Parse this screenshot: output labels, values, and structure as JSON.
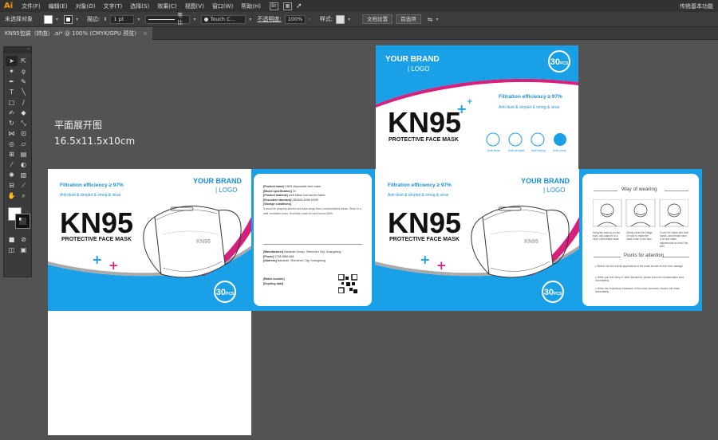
{
  "menu": {
    "logo": "Ai",
    "items": [
      "文件(F)",
      "编辑(E)",
      "对象(O)",
      "文字(T)",
      "选择(S)",
      "效果(C)",
      "视图(V)",
      "窗口(W)",
      "帮助(H)"
    ],
    "workspace": "传统基本功能"
  },
  "control": {
    "no_selection": "未选择对象",
    "stroke_label": "描边:",
    "stroke_value": "1 pt",
    "stroke_profile": "等比",
    "brush_name": "Touch C...",
    "opacity_label": "不透明度:",
    "opacity_value": "100%",
    "style_label": "样式:",
    "doc_setup": "文档设置",
    "preferences": "首选项"
  },
  "tab": {
    "title": "KN95包装（转曲）.ai* @ 100% (CMYK/GPU 预览)",
    "close": "×"
  },
  "canvas": {
    "label_title": "平面展开图",
    "label_dims": "16.5x11.5x10cm"
  },
  "box": {
    "brand_line1": "YOUR BRAND",
    "brand_line2": "| LOGO",
    "product": "KN95",
    "subtitle": "PROTECTIVE FACE MASK",
    "filtration": "Filtration efficiency ≥ 97%",
    "anti": "Anti-dust & droplet & smog & virus",
    "count": "30",
    "count_unit": "PCS",
    "mask_print": "KN95",
    "icons": [
      "Anti dust",
      "Anti droplet",
      "Anti smog",
      "Anti virus"
    ],
    "info_rows": [
      {
        "k": "[Product name]",
        "v": "KN95 disposable face mask"
      },
      {
        "k": "[Model specification]",
        "v": "30"
      },
      {
        "k": "[Product material]",
        "v": "melt-blown non-woven fabric"
      },
      {
        "k": "[Executive standard]",
        "v": "GB2626-2006 KN95"
      },
      {
        "k": "[Storage conditions]",
        "v": ""
      }
    ],
    "storage_text": "It must be properly stored and kept away from contaminated areas. Store in a well ventilated area. Humidity must be kept below 80%.",
    "company_rows": [
      {
        "k": "[Manufacturer]",
        "v": "Nanshan Group, Shenzhen City, Guangdong"
      },
      {
        "k": "[Phone]",
        "v": "0738 8888 888"
      },
      {
        "k": "[Address]",
        "v": "Nanshan, Shenzhen City, Guangdong"
      }
    ],
    "batch_rows": [
      {
        "k": "[Batch number]",
        "v": ""
      },
      {
        "k": "[Expiring date]",
        "v": ""
      }
    ],
    "way_title": "Way of wearing",
    "steps": [
      "Hang the earloop on the ears, and adjust it to a more comfortable state.",
      "Gently press the bridge of nose to make the mask close to the face.",
      "Cover the mask with both hands, and exhale blow a bit and make adjustments so that it fits well."
    ],
    "attention_title": "Points for attention",
    "attention": [
      "Before use,the overall appearance of the mask should be free from damage.",
      "When you feel dizzy or other discomfort, please leave the contaminated area immediately.",
      "When the respiratory resistance of the mask increases, replace the mask immediately."
    ]
  },
  "colors": {
    "accent_blue": "#1aa0e6",
    "accent_pink": "#d6217c",
    "canvas_bg": "#535353"
  }
}
